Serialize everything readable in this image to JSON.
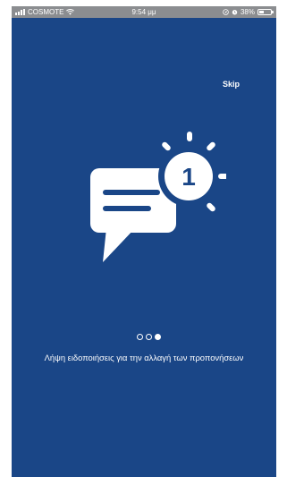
{
  "status_bar": {
    "carrier": "COSMOTE",
    "time": "9:54 μμ",
    "battery": "38%",
    "battery_level": 0.38
  },
  "onboarding": {
    "skip_label": "Skip",
    "badge_number": "1",
    "caption": "Λήψη ειδοποιήσεις για την αλλαγή των προπονήσεων",
    "page_count": 3,
    "active_page": 3
  },
  "colors": {
    "background": "#1a4687",
    "status_bar": "#8b8d90",
    "foreground": "#ffffff"
  },
  "icons": [
    "signal-icon",
    "wifi-icon",
    "location-icon",
    "alarm-icon",
    "battery-icon",
    "chat-bubble-icon",
    "notification-badge-icon"
  ]
}
